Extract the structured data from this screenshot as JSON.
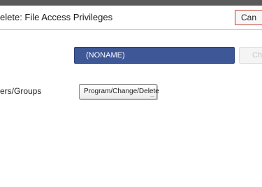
{
  "window": {
    "title": "elete: File Access Privileges",
    "cancel_label": "Can"
  },
  "name_row": {
    "value": "(NONAME)",
    "change_label": "Ch"
  },
  "users_row": {
    "label": "ers/Groups",
    "button_label": "Program/Change/Delete",
    "more_indicator": "..."
  }
}
